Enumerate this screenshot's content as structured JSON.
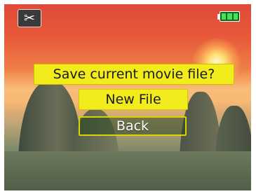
{
  "status_bar": {
    "mode_icon": "scissors-icon",
    "battery_icon": "battery-full-icon",
    "battery_level": 1.0,
    "battery_color": "#47e05a"
  },
  "dialog": {
    "title": "Save current movie file?",
    "buttons": [
      {
        "label": "New File",
        "selected": true
      },
      {
        "label": "Back",
        "selected": false
      }
    ],
    "accent_color": "#f2ec1c"
  }
}
